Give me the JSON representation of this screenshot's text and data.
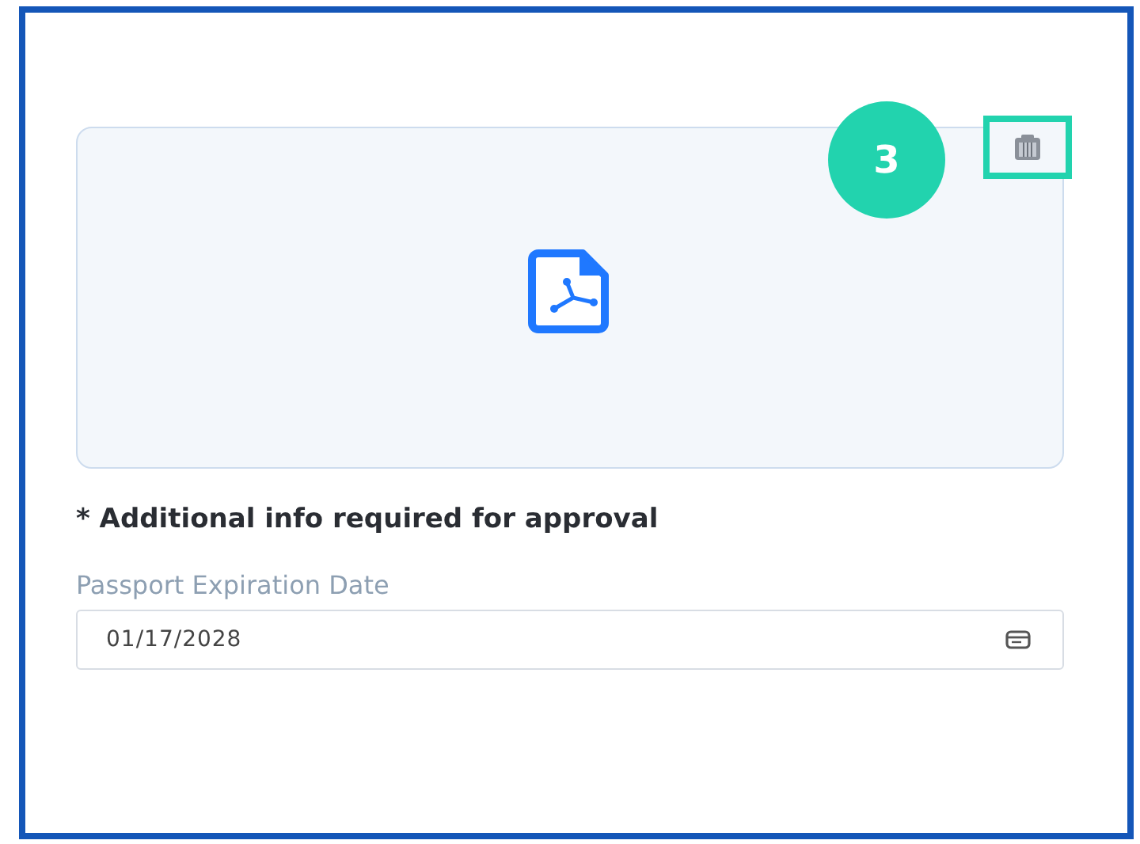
{
  "upload": {
    "callout": "3",
    "delete_highlighted": true
  },
  "note": "* Additional info required for approval",
  "date_field": {
    "label": "Passport Expiration Date",
    "value": "01/17/2028"
  }
}
